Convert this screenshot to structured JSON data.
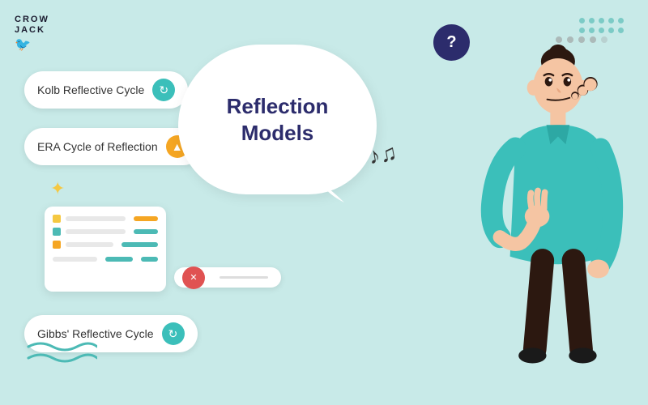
{
  "logo": {
    "line1": "CROW",
    "line2": "JACK"
  },
  "menu_items": [
    {
      "id": "kolb",
      "label": "Kolb Reflective Cycle",
      "icon": "↻",
      "icon_style": "teal"
    },
    {
      "id": "era",
      "label": "ERA Cycle of Reflection",
      "icon": "▲",
      "icon_style": "orange"
    },
    {
      "id": "gibbs",
      "label": "Gibbs' Reflective Cycle",
      "icon": "↻",
      "icon_style": "teal"
    }
  ],
  "x_item": {
    "icon": "✕",
    "icon_style": "red"
  },
  "speech_bubble": {
    "line1": "Reflection",
    "line2": "Models"
  },
  "question_bubble": {
    "symbol": "?"
  },
  "dots": {
    "count": 5
  },
  "colors": {
    "bg": "#c8eae8",
    "teal": "#3bbfba",
    "dark_blue": "#2c2c6c",
    "orange": "#f5a623",
    "red": "#e05252",
    "white": "#ffffff"
  }
}
